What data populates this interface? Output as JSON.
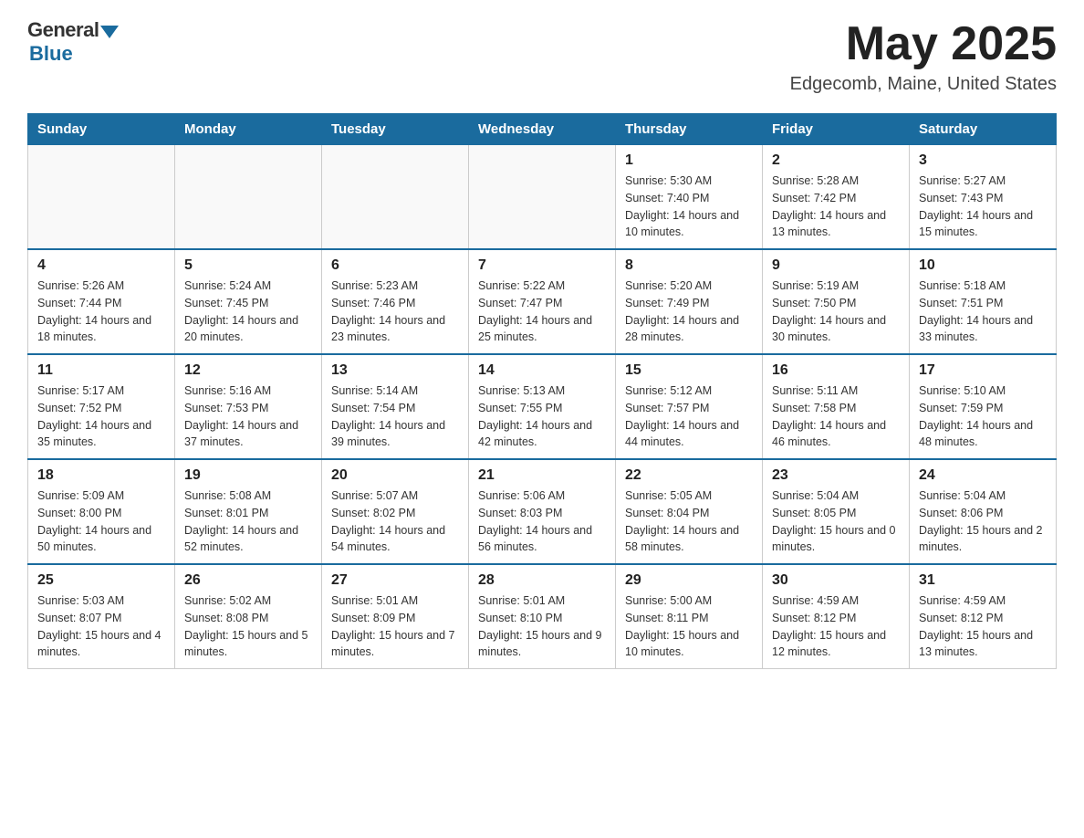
{
  "logo": {
    "general": "General",
    "blue": "Blue"
  },
  "title": "May 2025",
  "subtitle": "Edgecomb, Maine, United States",
  "weekdays": [
    "Sunday",
    "Monday",
    "Tuesday",
    "Wednesday",
    "Thursday",
    "Friday",
    "Saturday"
  ],
  "weeks": [
    [
      {
        "day": "",
        "info": ""
      },
      {
        "day": "",
        "info": ""
      },
      {
        "day": "",
        "info": ""
      },
      {
        "day": "",
        "info": ""
      },
      {
        "day": "1",
        "info": "Sunrise: 5:30 AM\nSunset: 7:40 PM\nDaylight: 14 hours and 10 minutes."
      },
      {
        "day": "2",
        "info": "Sunrise: 5:28 AM\nSunset: 7:42 PM\nDaylight: 14 hours and 13 minutes."
      },
      {
        "day": "3",
        "info": "Sunrise: 5:27 AM\nSunset: 7:43 PM\nDaylight: 14 hours and 15 minutes."
      }
    ],
    [
      {
        "day": "4",
        "info": "Sunrise: 5:26 AM\nSunset: 7:44 PM\nDaylight: 14 hours and 18 minutes."
      },
      {
        "day": "5",
        "info": "Sunrise: 5:24 AM\nSunset: 7:45 PM\nDaylight: 14 hours and 20 minutes."
      },
      {
        "day": "6",
        "info": "Sunrise: 5:23 AM\nSunset: 7:46 PM\nDaylight: 14 hours and 23 minutes."
      },
      {
        "day": "7",
        "info": "Sunrise: 5:22 AM\nSunset: 7:47 PM\nDaylight: 14 hours and 25 minutes."
      },
      {
        "day": "8",
        "info": "Sunrise: 5:20 AM\nSunset: 7:49 PM\nDaylight: 14 hours and 28 minutes."
      },
      {
        "day": "9",
        "info": "Sunrise: 5:19 AM\nSunset: 7:50 PM\nDaylight: 14 hours and 30 minutes."
      },
      {
        "day": "10",
        "info": "Sunrise: 5:18 AM\nSunset: 7:51 PM\nDaylight: 14 hours and 33 minutes."
      }
    ],
    [
      {
        "day": "11",
        "info": "Sunrise: 5:17 AM\nSunset: 7:52 PM\nDaylight: 14 hours and 35 minutes."
      },
      {
        "day": "12",
        "info": "Sunrise: 5:16 AM\nSunset: 7:53 PM\nDaylight: 14 hours and 37 minutes."
      },
      {
        "day": "13",
        "info": "Sunrise: 5:14 AM\nSunset: 7:54 PM\nDaylight: 14 hours and 39 minutes."
      },
      {
        "day": "14",
        "info": "Sunrise: 5:13 AM\nSunset: 7:55 PM\nDaylight: 14 hours and 42 minutes."
      },
      {
        "day": "15",
        "info": "Sunrise: 5:12 AM\nSunset: 7:57 PM\nDaylight: 14 hours and 44 minutes."
      },
      {
        "day": "16",
        "info": "Sunrise: 5:11 AM\nSunset: 7:58 PM\nDaylight: 14 hours and 46 minutes."
      },
      {
        "day": "17",
        "info": "Sunrise: 5:10 AM\nSunset: 7:59 PM\nDaylight: 14 hours and 48 minutes."
      }
    ],
    [
      {
        "day": "18",
        "info": "Sunrise: 5:09 AM\nSunset: 8:00 PM\nDaylight: 14 hours and 50 minutes."
      },
      {
        "day": "19",
        "info": "Sunrise: 5:08 AM\nSunset: 8:01 PM\nDaylight: 14 hours and 52 minutes."
      },
      {
        "day": "20",
        "info": "Sunrise: 5:07 AM\nSunset: 8:02 PM\nDaylight: 14 hours and 54 minutes."
      },
      {
        "day": "21",
        "info": "Sunrise: 5:06 AM\nSunset: 8:03 PM\nDaylight: 14 hours and 56 minutes."
      },
      {
        "day": "22",
        "info": "Sunrise: 5:05 AM\nSunset: 8:04 PM\nDaylight: 14 hours and 58 minutes."
      },
      {
        "day": "23",
        "info": "Sunrise: 5:04 AM\nSunset: 8:05 PM\nDaylight: 15 hours and 0 minutes."
      },
      {
        "day": "24",
        "info": "Sunrise: 5:04 AM\nSunset: 8:06 PM\nDaylight: 15 hours and 2 minutes."
      }
    ],
    [
      {
        "day": "25",
        "info": "Sunrise: 5:03 AM\nSunset: 8:07 PM\nDaylight: 15 hours and 4 minutes."
      },
      {
        "day": "26",
        "info": "Sunrise: 5:02 AM\nSunset: 8:08 PM\nDaylight: 15 hours and 5 minutes."
      },
      {
        "day": "27",
        "info": "Sunrise: 5:01 AM\nSunset: 8:09 PM\nDaylight: 15 hours and 7 minutes."
      },
      {
        "day": "28",
        "info": "Sunrise: 5:01 AM\nSunset: 8:10 PM\nDaylight: 15 hours and 9 minutes."
      },
      {
        "day": "29",
        "info": "Sunrise: 5:00 AM\nSunset: 8:11 PM\nDaylight: 15 hours and 10 minutes."
      },
      {
        "day": "30",
        "info": "Sunrise: 4:59 AM\nSunset: 8:12 PM\nDaylight: 15 hours and 12 minutes."
      },
      {
        "day": "31",
        "info": "Sunrise: 4:59 AM\nSunset: 8:12 PM\nDaylight: 15 hours and 13 minutes."
      }
    ]
  ]
}
